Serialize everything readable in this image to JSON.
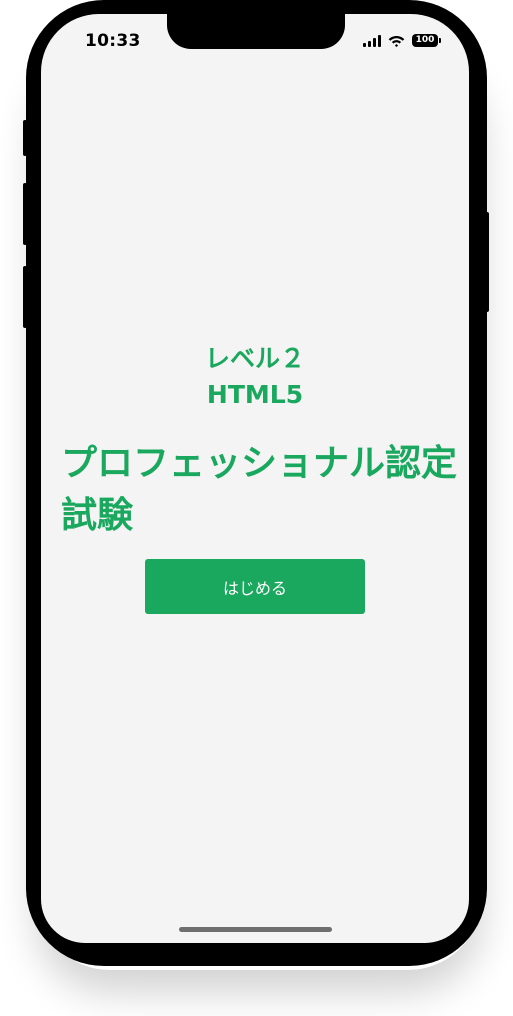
{
  "status_bar": {
    "time": "10:33",
    "battery": "100",
    "signal_icon": "cellular-signal-icon",
    "wifi_icon": "wifi-icon",
    "battery_icon": "battery-icon"
  },
  "main": {
    "level_line1": "レベル２",
    "level_line2": "HTML5",
    "exam_title": "プロフェッショナル認定試験",
    "start_button_label": "はじめる"
  },
  "colors": {
    "accent": "#1aa75e",
    "screen_background": "#f4f4f4",
    "button_text": "#ffffff"
  }
}
